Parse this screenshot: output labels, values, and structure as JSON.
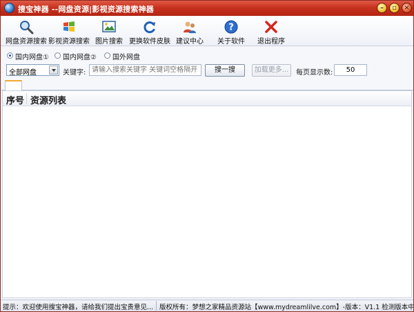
{
  "window": {
    "title": "搜宝神器 --网盘资源|影视资源搜索神器"
  },
  "toolbar": {
    "items": [
      {
        "label": "网盘资源搜索",
        "icon": "magnifier-icon"
      },
      {
        "label": "影视资源搜索",
        "icon": "windows-logo-icon"
      },
      {
        "label": "图片搜索",
        "icon": "picture-icon"
      },
      {
        "label": "更换软件皮肤",
        "icon": "refresh-icon"
      },
      {
        "label": "建议中心",
        "icon": "users-icon"
      },
      {
        "label": "关于软件",
        "icon": "help-icon"
      },
      {
        "label": "退出程序",
        "icon": "exit-x-icon"
      }
    ]
  },
  "source_options": [
    {
      "label": "国内网盘①",
      "selected": true
    },
    {
      "label": "国内网盘②",
      "selected": false
    },
    {
      "label": "国外网盘",
      "selected": false
    }
  ],
  "search": {
    "disk_select": "全部网盘",
    "keyword_label": "关键字:",
    "keyword_placeholder": "请输入搜索关键字 关键词空格隔开",
    "search_button": "搜一搜",
    "load_more_button": "加载更多...",
    "per_page_label": "每页显示数:",
    "per_page_value": "50"
  },
  "list": {
    "columns": [
      "序号",
      "资源列表"
    ],
    "rows": []
  },
  "status": {
    "left": "提示：欢迎使用搜宝神器，请给我们提出宝贵意见...",
    "right": "版权所有：梦想之家精品资源站【www.mydreamlilve.com】-版本：V1.1  检测版本中..."
  }
}
